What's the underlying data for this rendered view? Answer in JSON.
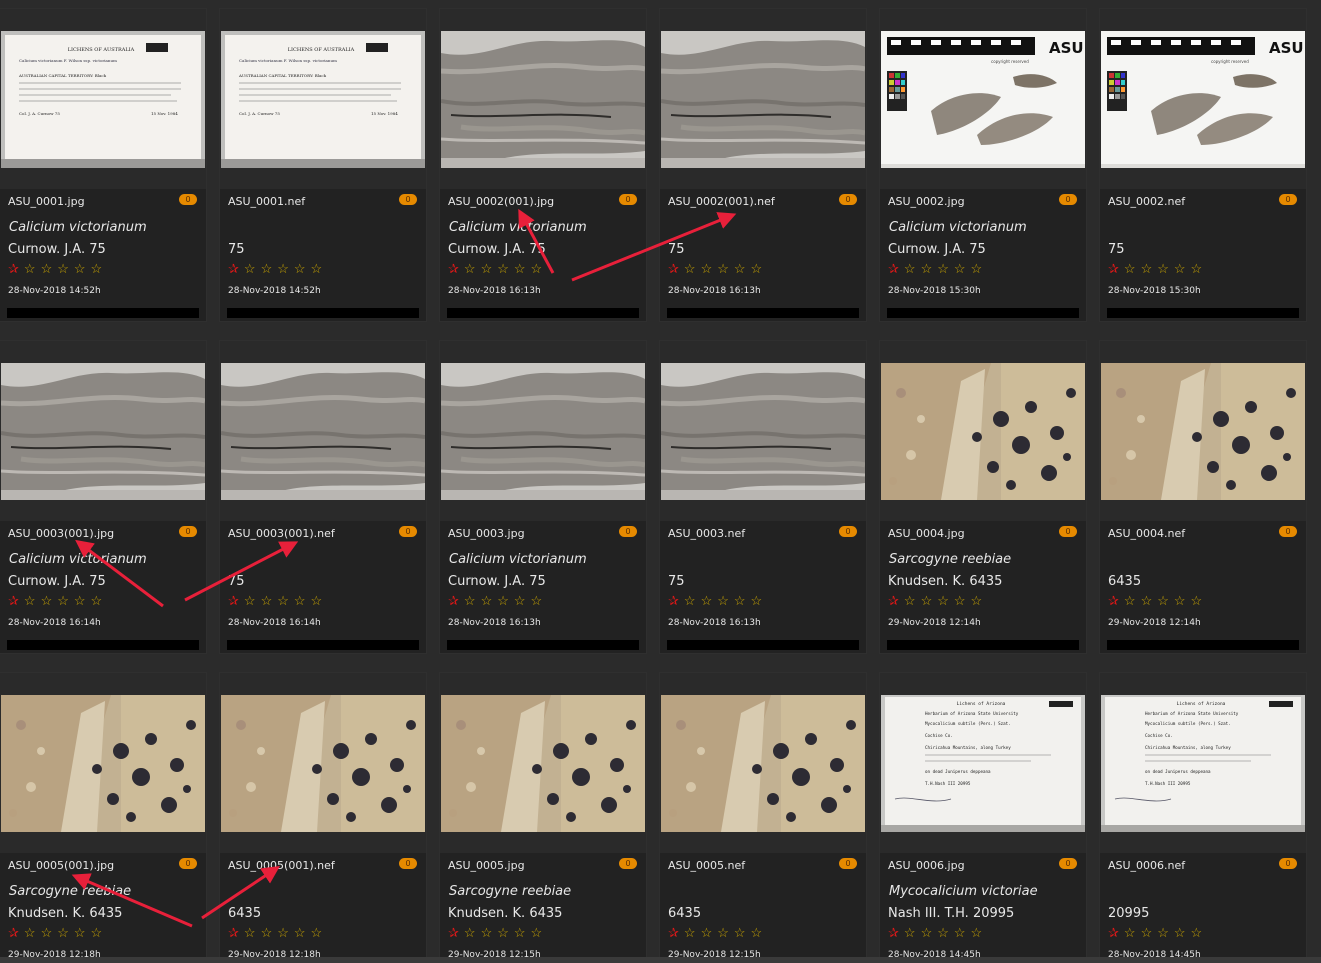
{
  "cards": [
    {
      "filename": "ASU_0001.jpg",
      "badge": "0",
      "taxon": "Calicium victorianum",
      "collector": "Curnow. J.A. 75",
      "date": "28-Nov-2018 14:52h",
      "rating": 0,
      "thumb": "label-card"
    },
    {
      "filename": "ASU_0001.nef",
      "badge": "0",
      "taxon": "",
      "collector": "75",
      "date": "28-Nov-2018 14:52h",
      "rating": 0,
      "thumb": "label-card"
    },
    {
      "filename": "ASU_0002(001).jpg",
      "badge": "0",
      "taxon": "Calicium victorianum",
      "collector": "Curnow. J.A. 75",
      "date": "28-Nov-2018 16:13h",
      "rating": 0,
      "thumb": "bark"
    },
    {
      "filename": "ASU_0002(001).nef",
      "badge": "0",
      "taxon": "",
      "collector": "75",
      "date": "28-Nov-2018 16:13h",
      "rating": 0,
      "thumb": "bark"
    },
    {
      "filename": "ASU_0002.jpg",
      "badge": "0",
      "taxon": "Calicium victorianum",
      "collector": "Curnow. J.A. 75",
      "date": "28-Nov-2018 15:30h",
      "rating": 0,
      "thumb": "specimen-scale"
    },
    {
      "filename": "ASU_0002.nef",
      "badge": "0",
      "taxon": "",
      "collector": "75",
      "date": "28-Nov-2018 15:30h",
      "rating": 0,
      "thumb": "specimen-scale"
    },
    {
      "filename": "ASU_0003(001).jpg",
      "badge": "0",
      "taxon": "Calicium victorianum",
      "collector": "Curnow. J.A. 75",
      "date": "28-Nov-2018 16:14h",
      "rating": 0,
      "thumb": "bark"
    },
    {
      "filename": "ASU_0003(001).nef",
      "badge": "0",
      "taxon": "",
      "collector": "75",
      "date": "28-Nov-2018 16:14h",
      "rating": 0,
      "thumb": "bark"
    },
    {
      "filename": "ASU_0003.jpg",
      "badge": "0",
      "taxon": "Calicium victorianum",
      "collector": "Curnow. J.A. 75",
      "date": "28-Nov-2018 16:13h",
      "rating": 0,
      "thumb": "bark"
    },
    {
      "filename": "ASU_0003.nef",
      "badge": "0",
      "taxon": "",
      "collector": "75",
      "date": "28-Nov-2018 16:13h",
      "rating": 0,
      "thumb": "bark"
    },
    {
      "filename": "ASU_0004.jpg",
      "badge": "0",
      "taxon": "Sarcogyne reebiae",
      "collector": "Knudsen. K. 6435",
      "date": "29-Nov-2018 12:14h",
      "rating": 0,
      "thumb": "lichen"
    },
    {
      "filename": "ASU_0004.nef",
      "badge": "0",
      "taxon": "",
      "collector": "6435",
      "date": "29-Nov-2018 12:14h",
      "rating": 0,
      "thumb": "lichen"
    },
    {
      "filename": "ASU_0005(001).jpg",
      "badge": "0",
      "taxon": "Sarcogyne reebiae",
      "collector": "Knudsen. K. 6435",
      "date": "29-Nov-2018 12:18h",
      "rating": 0,
      "thumb": "lichen"
    },
    {
      "filename": "ASU_0005(001).nef",
      "badge": "0",
      "taxon": "",
      "collector": "6435",
      "date": "29-Nov-2018 12:18h",
      "rating": 0,
      "thumb": "lichen"
    },
    {
      "filename": "ASU_0005.jpg",
      "badge": "0",
      "taxon": "Sarcogyne reebiae",
      "collector": "Knudsen. K. 6435",
      "date": "29-Nov-2018 12:15h",
      "rating": 0,
      "thumb": "lichen"
    },
    {
      "filename": "ASU_0005.nef",
      "badge": "0",
      "taxon": "",
      "collector": "6435",
      "date": "29-Nov-2018 12:15h",
      "rating": 0,
      "thumb": "lichen"
    },
    {
      "filename": "ASU_0006.jpg",
      "badge": "0",
      "taxon": "Mycocalicium victoriae",
      "collector": "Nash III. T.H. 20995",
      "date": "28-Nov-2018 14:45h",
      "rating": 0,
      "thumb": "typed-label"
    },
    {
      "filename": "ASU_0006.nef",
      "badge": "0",
      "taxon": "",
      "collector": "20995",
      "date": "28-Nov-2018 14:45h",
      "rating": 0,
      "thumb": "typed-label"
    }
  ],
  "thumb_texts": {
    "label_header": "LICHENS OF AUSTRALIA",
    "label_species": "Calicium victorianum F. Wilson ssp. victorianum",
    "label_territory": "AUSTRALIAN CAPITAL TERRITORY: Black",
    "label_collector": "Col. J. A. Curnow 75",
    "label_date": "15 Nov. 1984",
    "scale_logo": "ASU",
    "scale_copyright": "copyright reserved",
    "typed_header": "Lichens of Arizona",
    "typed_herbarium": "Herbarium of Arizona State University",
    "typed_species": "Mycocalicium subtile (Pers.) Szat.",
    "typed_county": "Cochise Co.",
    "typed_locality": "Chiricahua Mountains, along Turkey",
    "typed_substrate": "on dead Juniperus deppeana",
    "typed_collector": "T.H.Nash III   20995"
  },
  "colors": {
    "accent_badge": "#e68a00",
    "star": "#c8a400",
    "reject": "#e01818",
    "annotation_arrow": "#e8203a"
  },
  "icons": {
    "star": "★",
    "reject": "✰"
  }
}
